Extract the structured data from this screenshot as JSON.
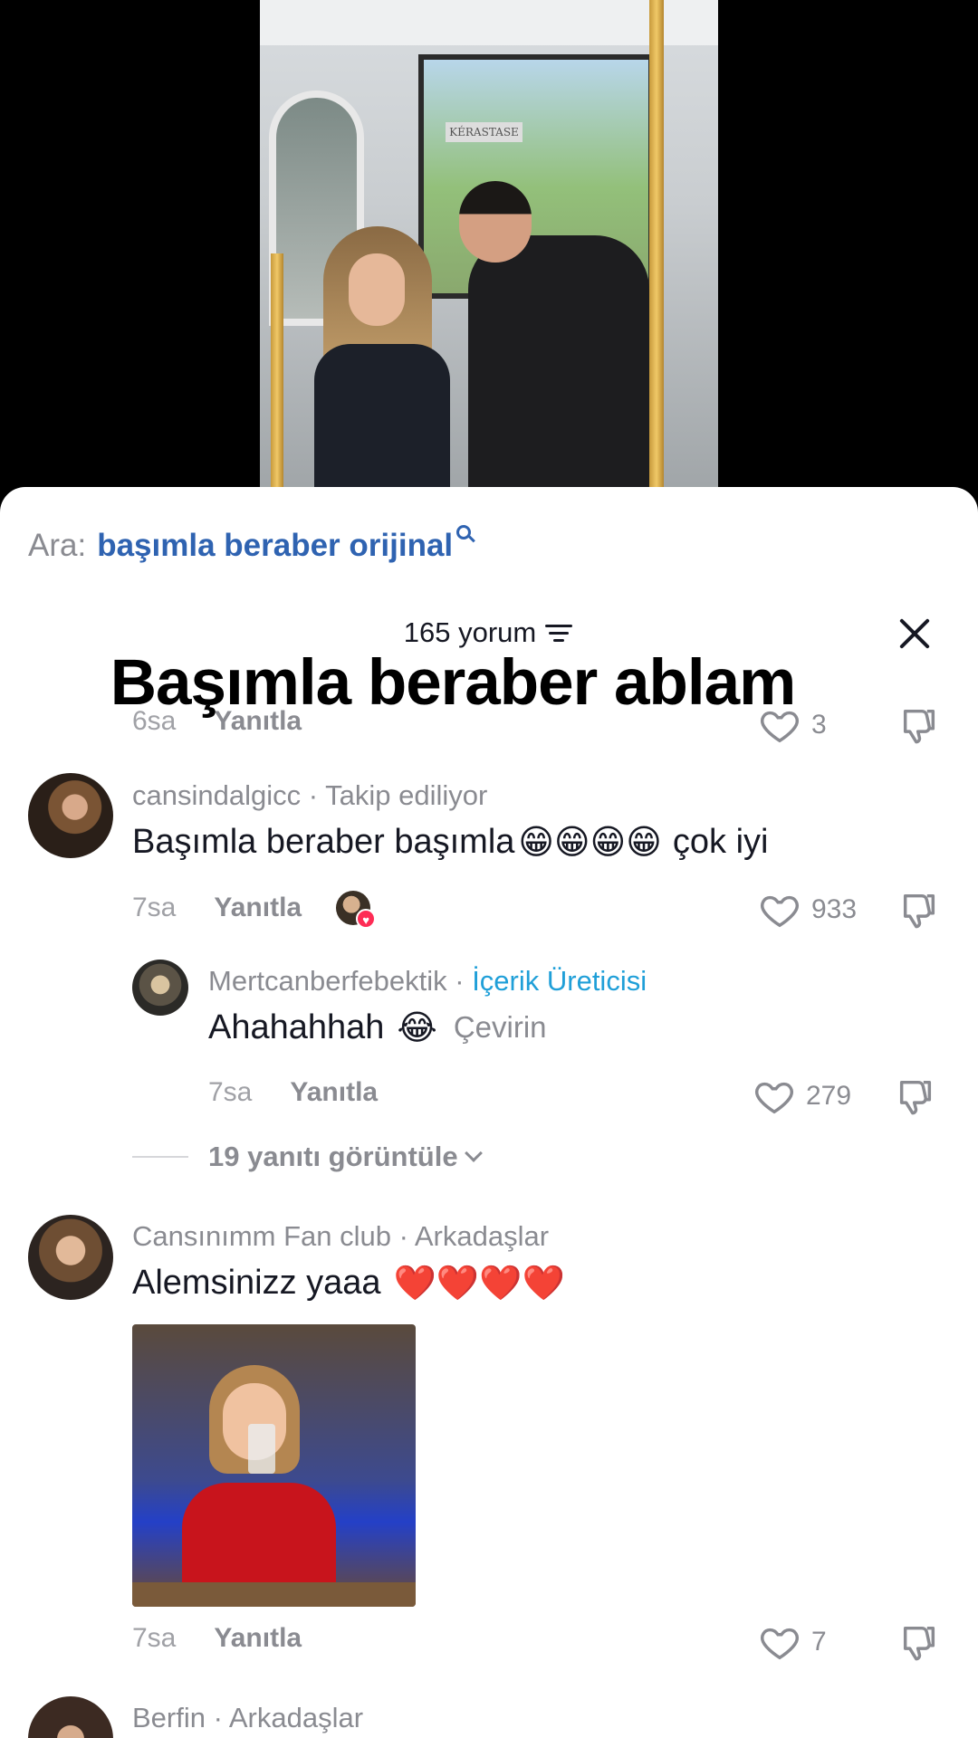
{
  "video": {
    "sign_text": "KÉRASTASE"
  },
  "search": {
    "prefix": "Ara:",
    "query": "başımla beraber orijinal",
    "icon": "search-icon"
  },
  "comments_header": {
    "count_label": "165 yorum"
  },
  "overlay_title": "Başımla beraber ablam",
  "prev_comment": {
    "time": "6sa",
    "reply_label": "Yanıtla",
    "likes": "3"
  },
  "comment1": {
    "username": "cansindalgicc",
    "tag": "Takip ediliyor",
    "text": "Başımla beraber başımla",
    "emojis": "😁😁😁😁",
    "text_after": "çok iyi",
    "time": "7sa",
    "reply_label": "Yanıtla",
    "likes": "933"
  },
  "reply1": {
    "username": "Mertcanberfebektik",
    "tag": "İçerik Üreticisi",
    "text": "Ahahahhah",
    "emoji": "😂",
    "translate_label": "Çevirin",
    "time": "7sa",
    "reply_label": "Yanıtla",
    "likes": "279"
  },
  "view_replies_label": "19 yanıtı görüntüle",
  "comment2": {
    "username": "Cansınımm Fan club",
    "tag": "Arkadaşlar",
    "text": "Alemsinizz yaaa",
    "emojis": "❤️❤️❤️❤️",
    "time": "7sa",
    "reply_label": "Yanıtla",
    "likes": "7"
  },
  "comment3": {
    "username": "Berfin",
    "tag": "Arkadaşlar"
  },
  "colors": {
    "accent_link": "#2f63b1",
    "creator_tag": "#1f9fd8",
    "muted": "#8a8b91",
    "like_heart": "#fe2c55"
  }
}
